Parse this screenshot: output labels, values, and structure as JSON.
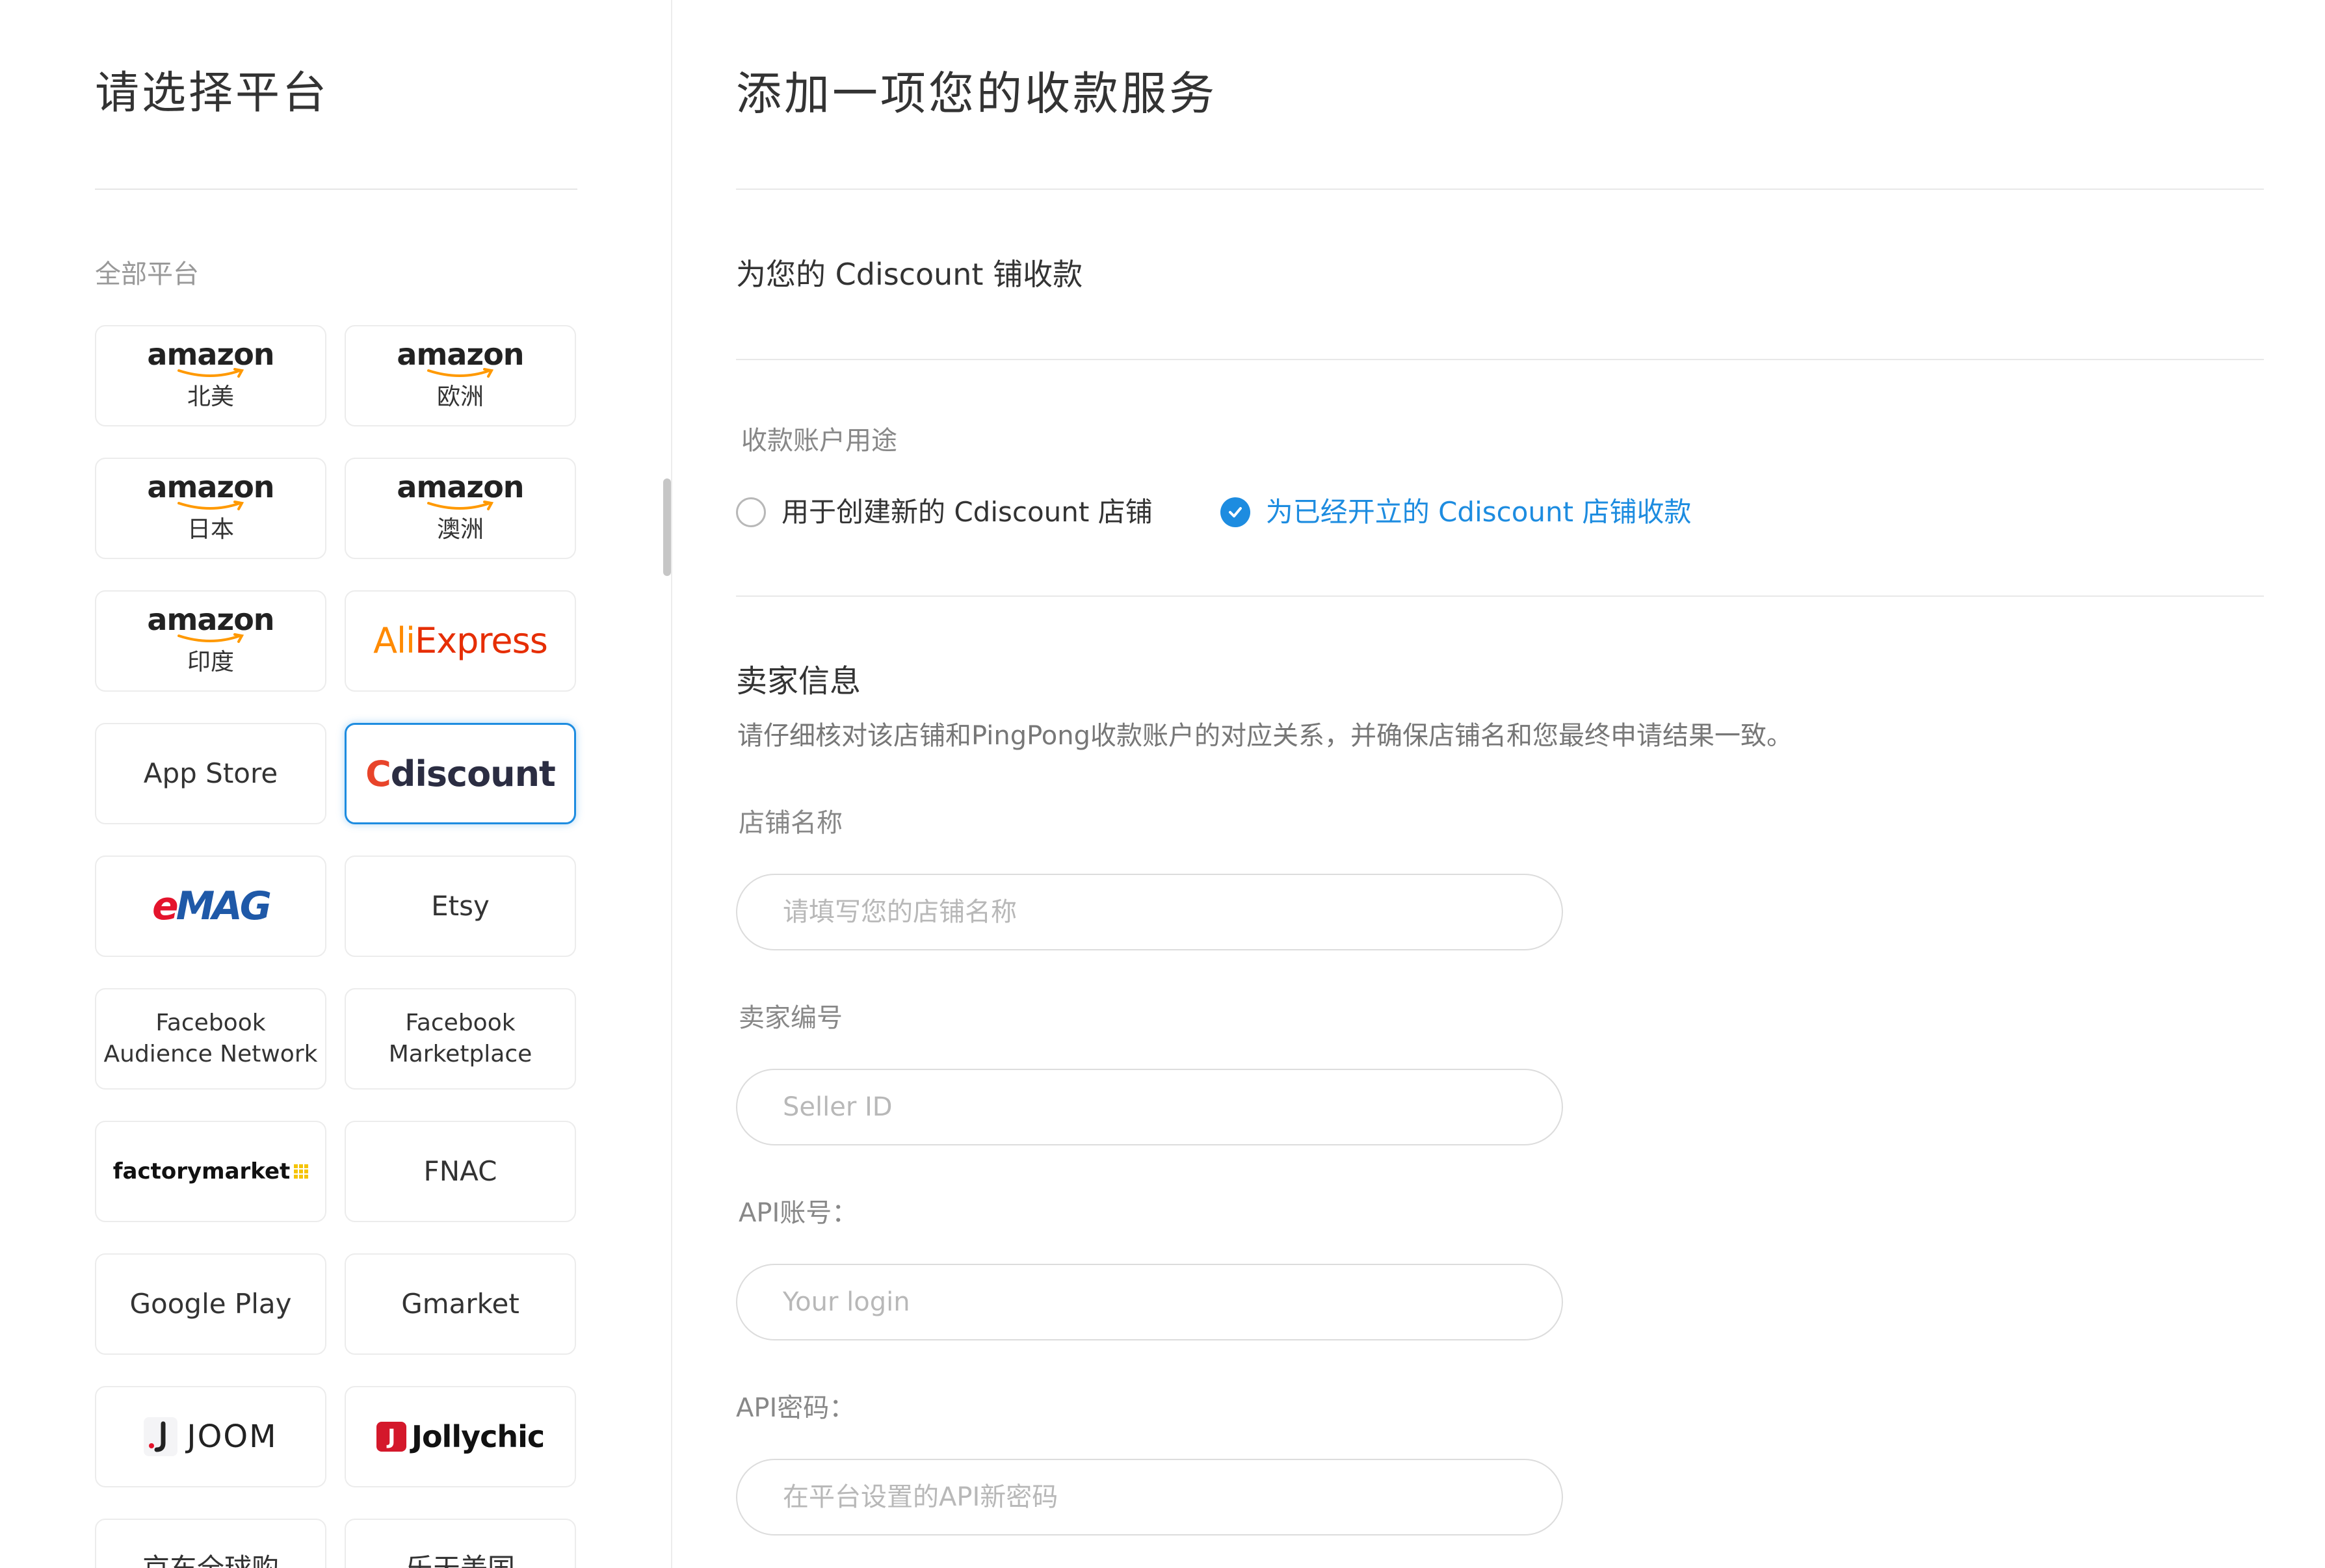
{
  "left": {
    "title": "请选择平台",
    "group_label": "全部平台",
    "platforms": [
      {
        "name": "amazon",
        "region": "北美"
      },
      {
        "name": "amazon",
        "region": "欧洲"
      },
      {
        "name": "amazon",
        "region": "日本"
      },
      {
        "name": "amazon",
        "region": "澳洲"
      },
      {
        "name": "amazon",
        "region": "印度"
      },
      {
        "name_a": "Ali",
        "name_b": "Express"
      },
      {
        "name": "App Store"
      },
      {
        "name_a": "C",
        "name_b": "discount",
        "selected": true
      },
      {
        "name_a": "e",
        "name_b": "MAG"
      },
      {
        "name": "Etsy"
      },
      {
        "line1": "Facebook",
        "line2": "Audience Network"
      },
      {
        "line1": "Facebook",
        "line2": "Marketplace"
      },
      {
        "name": "factorymarket"
      },
      {
        "name": "FNAC"
      },
      {
        "name": "Google Play"
      },
      {
        "name": "Gmarket"
      },
      {
        "name": "JOOM"
      },
      {
        "mark": "J",
        "name": "Jollychic"
      },
      {
        "name": "京东全球购"
      },
      {
        "name": "乐天美国"
      }
    ]
  },
  "right": {
    "title": "添加一项您的收款服务",
    "subtitle": "为您的 Cdiscount 铺收款",
    "usage": {
      "label": "收款账户用途",
      "options": [
        {
          "label": "用于创建新的 Cdiscount 店铺",
          "selected": false
        },
        {
          "label": "为已经开立的 Cdiscount 店铺收款",
          "selected": true
        }
      ]
    },
    "seller": {
      "title": "卖家信息",
      "description": "请仔细核对该店铺和PingPong收款账户的对应关系，并确保店铺名和您最终申请结果一致。"
    },
    "fields": {
      "store_name": {
        "label": "店铺名称",
        "placeholder": "请填写您的店铺名称"
      },
      "seller_id": {
        "label": "卖家编号",
        "placeholder": "Seller ID"
      },
      "api_account": {
        "label": "API账号：",
        "placeholder": "Your login"
      },
      "api_password": {
        "label": "API密码：",
        "placeholder": "在平台设置的API新密码"
      }
    }
  },
  "colors": {
    "accent": "#1d8ce0",
    "amazon_smile": "#ff9900",
    "aliexpress_orange": "#ff8a00",
    "aliexpress_red": "#e62e04",
    "cdiscount_red": "#e8442a",
    "emag_red": "#e4142c",
    "emag_blue": "#1f59a8",
    "jollychic_red": "#d4182b"
  },
  "icons": {
    "radio_selected": "check-circle-icon",
    "radio_unselected": "empty-circle-icon",
    "amazon_logo_smile": "smile-arrow-icon",
    "joom_logo": "joom-j-icon",
    "factorymarket_logo": "dot-grid-icon"
  }
}
